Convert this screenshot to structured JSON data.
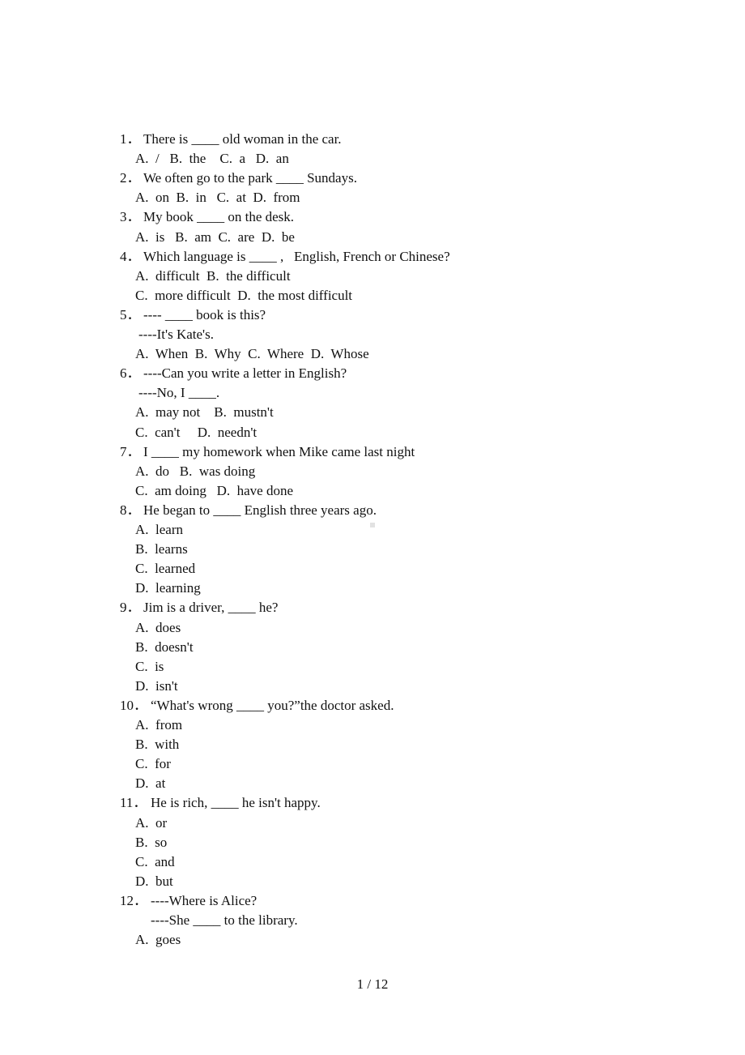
{
  "document": {
    "questions": [
      {
        "number": "1．",
        "stem": [
          "There is ____ old woman in the car."
        ],
        "option_lines": [
          "A.  /   B.  the    C.  a   D.  an"
        ]
      },
      {
        "number": "2．",
        "stem": [
          "We often go to the park ____ Sundays."
        ],
        "option_lines": [
          "A.  on  B.  in   C.  at  D.  from"
        ]
      },
      {
        "number": "3．",
        "stem": [
          "My book ____ on the desk."
        ],
        "option_lines": [
          "A.  is   B.  am  C.  are  D.  be"
        ]
      },
      {
        "number": "4．",
        "stem": [
          "Which language is ____ ,   English, French or Chinese?"
        ],
        "option_lines": [
          "A.  difficult  B.  the difficult",
          "C.  more difficult  D.  the most difficult"
        ]
      },
      {
        "number": "5．",
        "stem": [
          "---- ____ book is this?",
          "----It's Kate's."
        ],
        "option_lines": [
          "A.  When  B.  Why  C.  Where  D.  Whose"
        ]
      },
      {
        "number": "6．",
        "stem": [
          "----Can you write a letter in English?",
          "----No, I ____."
        ],
        "option_lines": [
          "A.  may not    B.  mustn't",
          "C.  can't     D.  needn't"
        ]
      },
      {
        "number": "7．",
        "stem": [
          "I ____ my homework when Mike came last night"
        ],
        "option_lines": [
          "A.  do   B.  was doing",
          "C.  am doing   D.  have done"
        ]
      },
      {
        "number": "8．",
        "stem": [
          "He began to ____ English three years ago."
        ],
        "option_lines": [
          "A.  learn",
          "B.  learns",
          "C.  learned",
          "D.  learning"
        ]
      },
      {
        "number": "9．",
        "stem": [
          "Jim is a driver, ____ he?"
        ],
        "option_lines": [
          "A.  does",
          "B.  doesn't",
          "C.  is",
          "D.  isn't"
        ]
      },
      {
        "number": "10．",
        "stem": [
          "“What's wrong ____ you?”the doctor asked."
        ],
        "option_lines": [
          "A.  from",
          "B.  with",
          "C.  for",
          "D.  at"
        ]
      },
      {
        "number": "11．",
        "stem": [
          "He is rich, ____ he isn't happy."
        ],
        "option_lines": [
          "A.  or",
          "B.  so",
          "C.  and",
          "D.  but"
        ]
      },
      {
        "number": "12．",
        "stem": [
          "----Where is Alice?",
          "----She ____ to the library."
        ],
        "option_lines": [
          "A.  goes"
        ]
      }
    ],
    "page_indicator": "1 / 12"
  }
}
